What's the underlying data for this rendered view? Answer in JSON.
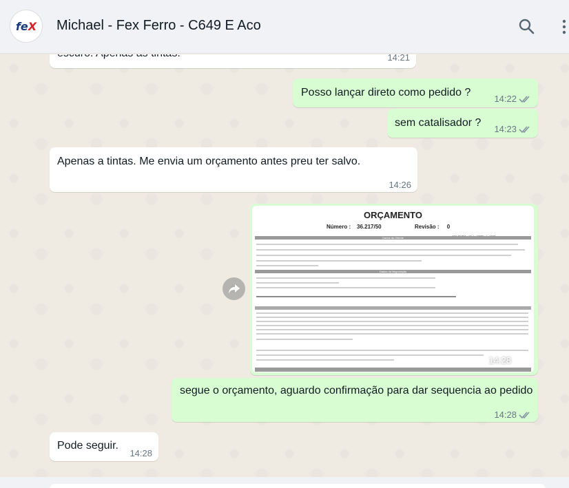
{
  "header": {
    "title": "Michael - Fex Ferro - C649 E Aco",
    "avatar_text_main": "fe",
    "avatar_text_accent": "X",
    "icons": [
      "search-icon",
      "menu-icon"
    ]
  },
  "messages": [
    {
      "dir": "in",
      "text": "escuro. Apenas as tintas.",
      "time": "14:21"
    },
    {
      "dir": "out",
      "text": "Posso lançar direto como pedido ?",
      "time": "14:22",
      "status": "read"
    },
    {
      "dir": "out",
      "text": "sem catalisador ?",
      "time": "14:23",
      "status": "read"
    },
    {
      "dir": "in",
      "text": "Apenas a tintas. Me envia um orçamento antes preu ter salvo.",
      "time": "14:26"
    },
    {
      "dir": "out",
      "type": "image",
      "time": "14:28",
      "status": "read"
    },
    {
      "dir": "out",
      "text": "segue o orçamento, aguardo confirmação para dar sequencia ao pedido",
      "time": "14:28",
      "status": "read"
    },
    {
      "dir": "in",
      "text": "Pode seguir.",
      "time": "14:28"
    }
  ],
  "document": {
    "title": "ORÇAMENTO",
    "number_label": "Número :",
    "number_value": "36.217/50",
    "revision_label": "Revisão :",
    "revision_value": "0",
    "date_text": "COLOMBO , 16 de ABRIL de 2025",
    "section_client": "Dados do Cliente",
    "section_negotiation": "Dados da Negociação",
    "section_notes": "Observações"
  },
  "colors": {
    "incoming": "#ffffff",
    "outgoing": "#d9fdd3",
    "read_ticks": "#53bdeb",
    "background": "#efeae2"
  }
}
